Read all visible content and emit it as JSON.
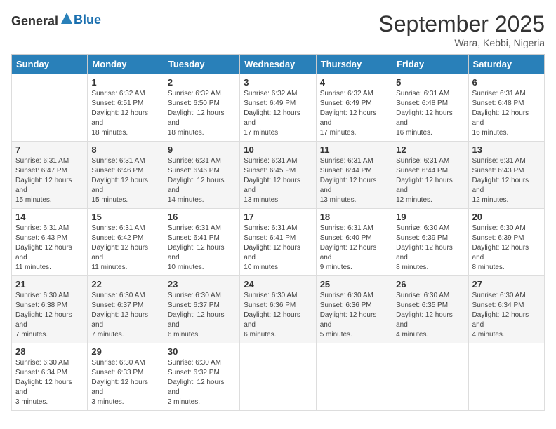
{
  "header": {
    "logo_general": "General",
    "logo_blue": "Blue",
    "month": "September 2025",
    "location": "Wara, Kebbi, Nigeria"
  },
  "days_of_week": [
    "Sunday",
    "Monday",
    "Tuesday",
    "Wednesday",
    "Thursday",
    "Friday",
    "Saturday"
  ],
  "weeks": [
    [
      {
        "day": "",
        "info": ""
      },
      {
        "day": "1",
        "info": "Sunrise: 6:32 AM\nSunset: 6:51 PM\nDaylight: 12 hours and 18 minutes."
      },
      {
        "day": "2",
        "info": "Sunrise: 6:32 AM\nSunset: 6:50 PM\nDaylight: 12 hours and 18 minutes."
      },
      {
        "day": "3",
        "info": "Sunrise: 6:32 AM\nSunset: 6:49 PM\nDaylight: 12 hours and 17 minutes."
      },
      {
        "day": "4",
        "info": "Sunrise: 6:32 AM\nSunset: 6:49 PM\nDaylight: 12 hours and 17 minutes."
      },
      {
        "day": "5",
        "info": "Sunrise: 6:31 AM\nSunset: 6:48 PM\nDaylight: 12 hours and 16 minutes."
      },
      {
        "day": "6",
        "info": "Sunrise: 6:31 AM\nSunset: 6:48 PM\nDaylight: 12 hours and 16 minutes."
      }
    ],
    [
      {
        "day": "7",
        "info": "Sunrise: 6:31 AM\nSunset: 6:47 PM\nDaylight: 12 hours and 15 minutes."
      },
      {
        "day": "8",
        "info": "Sunrise: 6:31 AM\nSunset: 6:46 PM\nDaylight: 12 hours and 15 minutes."
      },
      {
        "day": "9",
        "info": "Sunrise: 6:31 AM\nSunset: 6:46 PM\nDaylight: 12 hours and 14 minutes."
      },
      {
        "day": "10",
        "info": "Sunrise: 6:31 AM\nSunset: 6:45 PM\nDaylight: 12 hours and 13 minutes."
      },
      {
        "day": "11",
        "info": "Sunrise: 6:31 AM\nSunset: 6:44 PM\nDaylight: 12 hours and 13 minutes."
      },
      {
        "day": "12",
        "info": "Sunrise: 6:31 AM\nSunset: 6:44 PM\nDaylight: 12 hours and 12 minutes."
      },
      {
        "day": "13",
        "info": "Sunrise: 6:31 AM\nSunset: 6:43 PM\nDaylight: 12 hours and 12 minutes."
      }
    ],
    [
      {
        "day": "14",
        "info": "Sunrise: 6:31 AM\nSunset: 6:43 PM\nDaylight: 12 hours and 11 minutes."
      },
      {
        "day": "15",
        "info": "Sunrise: 6:31 AM\nSunset: 6:42 PM\nDaylight: 12 hours and 11 minutes."
      },
      {
        "day": "16",
        "info": "Sunrise: 6:31 AM\nSunset: 6:41 PM\nDaylight: 12 hours and 10 minutes."
      },
      {
        "day": "17",
        "info": "Sunrise: 6:31 AM\nSunset: 6:41 PM\nDaylight: 12 hours and 10 minutes."
      },
      {
        "day": "18",
        "info": "Sunrise: 6:31 AM\nSunset: 6:40 PM\nDaylight: 12 hours and 9 minutes."
      },
      {
        "day": "19",
        "info": "Sunrise: 6:30 AM\nSunset: 6:39 PM\nDaylight: 12 hours and 8 minutes."
      },
      {
        "day": "20",
        "info": "Sunrise: 6:30 AM\nSunset: 6:39 PM\nDaylight: 12 hours and 8 minutes."
      }
    ],
    [
      {
        "day": "21",
        "info": "Sunrise: 6:30 AM\nSunset: 6:38 PM\nDaylight: 12 hours and 7 minutes."
      },
      {
        "day": "22",
        "info": "Sunrise: 6:30 AM\nSunset: 6:37 PM\nDaylight: 12 hours and 7 minutes."
      },
      {
        "day": "23",
        "info": "Sunrise: 6:30 AM\nSunset: 6:37 PM\nDaylight: 12 hours and 6 minutes."
      },
      {
        "day": "24",
        "info": "Sunrise: 6:30 AM\nSunset: 6:36 PM\nDaylight: 12 hours and 6 minutes."
      },
      {
        "day": "25",
        "info": "Sunrise: 6:30 AM\nSunset: 6:36 PM\nDaylight: 12 hours and 5 minutes."
      },
      {
        "day": "26",
        "info": "Sunrise: 6:30 AM\nSunset: 6:35 PM\nDaylight: 12 hours and 4 minutes."
      },
      {
        "day": "27",
        "info": "Sunrise: 6:30 AM\nSunset: 6:34 PM\nDaylight: 12 hours and 4 minutes."
      }
    ],
    [
      {
        "day": "28",
        "info": "Sunrise: 6:30 AM\nSunset: 6:34 PM\nDaylight: 12 hours and 3 minutes."
      },
      {
        "day": "29",
        "info": "Sunrise: 6:30 AM\nSunset: 6:33 PM\nDaylight: 12 hours and 3 minutes."
      },
      {
        "day": "30",
        "info": "Sunrise: 6:30 AM\nSunset: 6:32 PM\nDaylight: 12 hours and 2 minutes."
      },
      {
        "day": "",
        "info": ""
      },
      {
        "day": "",
        "info": ""
      },
      {
        "day": "",
        "info": ""
      },
      {
        "day": "",
        "info": ""
      }
    ]
  ]
}
